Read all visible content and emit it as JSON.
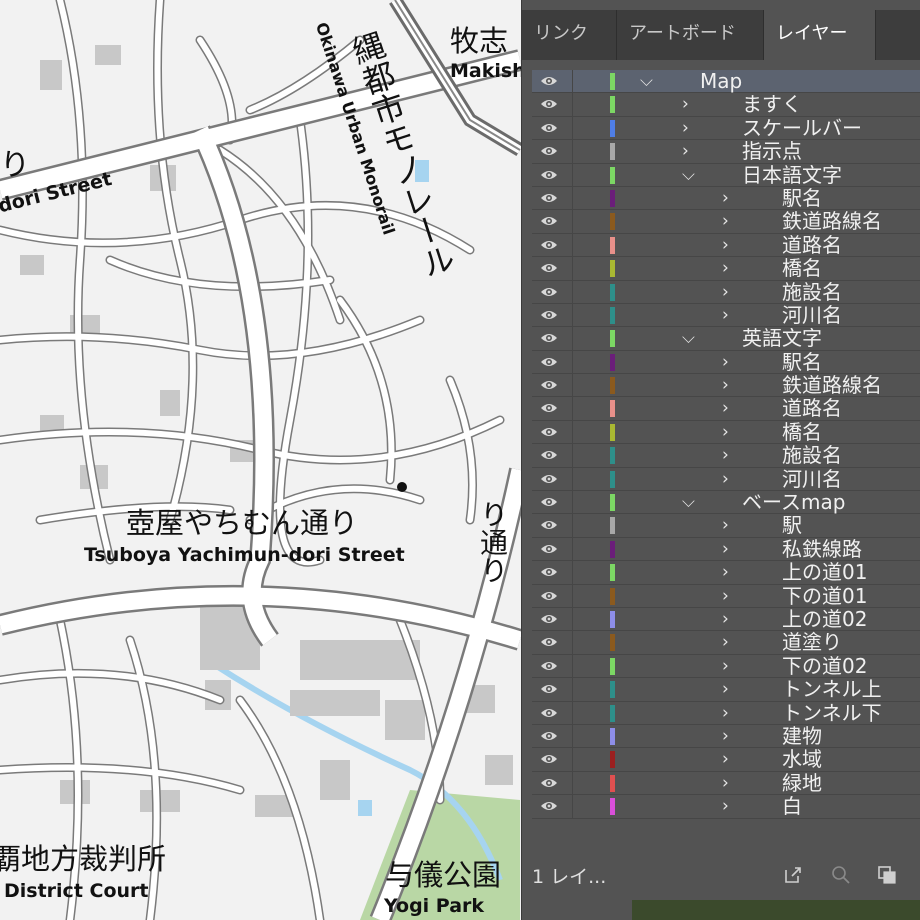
{
  "map": {
    "labels": {
      "makishi_ja": "牧志",
      "makishi_en": "Makishi",
      "monorail_ja": "縄都市モノレール",
      "monorail_en": "Okinawa Urban Monorail",
      "dori_ja_left": "り",
      "dori_en_left": "dori Street",
      "tsuboya_ja": "壺屋やちむん通り",
      "tsuboya_en": "Tsuboya Yachimun-dori Street",
      "dori_vert_right": "り通り",
      "court_ja": "覇地方裁判所",
      "court_en": "District Court",
      "yogi_ja": "与儀公園",
      "yogi_en": "Yogi Park"
    },
    "colors": {
      "background": "#f2f2f2",
      "road": "#ffffff",
      "road_outline": "#7a7a7a",
      "building": "#c8c8c8",
      "water": "#a6d4f0",
      "park": "#b9d7a5"
    }
  },
  "panel": {
    "tabs": [
      "リンク",
      "アートボード",
      "レイヤー"
    ],
    "active_tab": "レイヤー",
    "layers": [
      {
        "name": "Map",
        "color": "#7cd764",
        "level": 0,
        "expanded": true
      },
      {
        "name": "ますく",
        "color": "#7cd764",
        "level": 1,
        "expanded": false
      },
      {
        "name": "スケールバー",
        "color": "#4f7ee6",
        "level": 1,
        "expanded": false
      },
      {
        "name": "指示点",
        "color": "#a8a8a8",
        "level": 1,
        "expanded": false
      },
      {
        "name": "日本語文字",
        "color": "#7cd764",
        "level": 1,
        "expanded": true
      },
      {
        "name": "駅名",
        "color": "#6b1e7a",
        "level": 2,
        "expanded": false
      },
      {
        "name": "鉄道路線名",
        "color": "#8b5a1e",
        "level": 2,
        "expanded": false
      },
      {
        "name": "道路名",
        "color": "#e8908a",
        "level": 2,
        "expanded": false
      },
      {
        "name": "橋名",
        "color": "#a9b832",
        "level": 2,
        "expanded": false
      },
      {
        "name": "施設名",
        "color": "#2e8f8a",
        "level": 2,
        "expanded": false
      },
      {
        "name": "河川名",
        "color": "#2e8f8a",
        "level": 2,
        "expanded": false
      },
      {
        "name": "英語文字",
        "color": "#7cd764",
        "level": 1,
        "expanded": true
      },
      {
        "name": "駅名",
        "color": "#6b1e7a",
        "level": 2,
        "expanded": false
      },
      {
        "name": "鉄道路線名",
        "color": "#8b5a1e",
        "level": 2,
        "expanded": false
      },
      {
        "name": "道路名",
        "color": "#e8908a",
        "level": 2,
        "expanded": false
      },
      {
        "name": "橋名",
        "color": "#a9b832",
        "level": 2,
        "expanded": false
      },
      {
        "name": "施設名",
        "color": "#2e8f8a",
        "level": 2,
        "expanded": false
      },
      {
        "name": "河川名",
        "color": "#2e8f8a",
        "level": 2,
        "expanded": false
      },
      {
        "name": "ベースmap",
        "color": "#7cd764",
        "level": 1,
        "expanded": true
      },
      {
        "name": "駅",
        "color": "#a8a8a8",
        "level": 2,
        "expanded": false
      },
      {
        "name": "私鉄線路",
        "color": "#6b1e7a",
        "level": 2,
        "expanded": false
      },
      {
        "name": "上の道01",
        "color": "#7cd764",
        "level": 2,
        "expanded": false
      },
      {
        "name": "下の道01",
        "color": "#8b5a1e",
        "level": 2,
        "expanded": false
      },
      {
        "name": "上の道02",
        "color": "#8e8ee8",
        "level": 2,
        "expanded": false
      },
      {
        "name": "道塗り",
        "color": "#8b5a1e",
        "level": 2,
        "expanded": false
      },
      {
        "name": "下の道02",
        "color": "#7cd764",
        "level": 2,
        "expanded": false
      },
      {
        "name": "トンネル上",
        "color": "#2e8f8a",
        "level": 2,
        "expanded": false
      },
      {
        "name": "トンネル下",
        "color": "#2e8f8a",
        "level": 2,
        "expanded": false
      },
      {
        "name": "建物",
        "color": "#8e8ee8",
        "level": 2,
        "expanded": false
      },
      {
        "name": "水域",
        "color": "#9b1f1f",
        "level": 2,
        "expanded": false
      },
      {
        "name": "緑地",
        "color": "#e05050",
        "level": 2,
        "expanded": false
      },
      {
        "name": "白",
        "color": "#d94fd9",
        "level": 2,
        "expanded": false
      }
    ],
    "footer": {
      "count_label": "1 レイ...",
      "icons": [
        "export-icon",
        "search-icon",
        "arrange-icon"
      ]
    }
  }
}
